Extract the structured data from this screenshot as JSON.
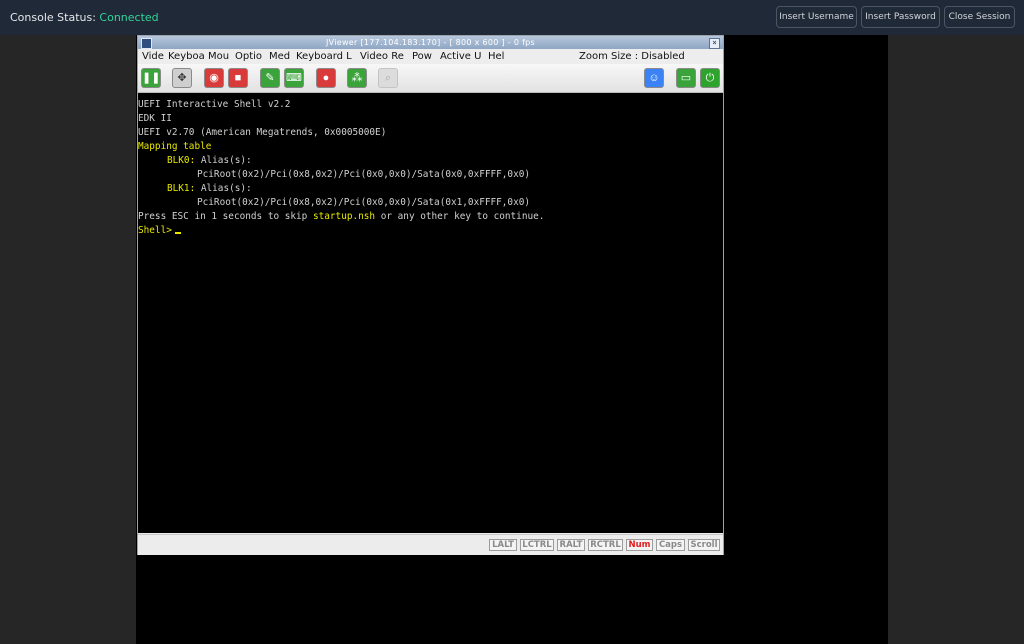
{
  "header": {
    "status_label": "Console Status:",
    "status_value": "Connected",
    "buttons": [
      {
        "label": "Insert Username"
      },
      {
        "label": "Insert Password"
      },
      {
        "label": "Close Session"
      }
    ]
  },
  "viewer": {
    "title": "JViewer [177.104.183.170] - [ 800 x 600 ] - 0 fps",
    "menu": [
      "Vide",
      "Keyboa",
      "Mou",
      "Optio",
      "Med",
      "Keyboard L",
      "Video Re",
      "Pow",
      "Active U",
      "Hel"
    ],
    "zoom_label": "Zoom Size :",
    "zoom_value": "Disabled",
    "toolbar_icons": [
      {
        "name": "pause-icon",
        "color": "#3aa33a"
      },
      {
        "name": "fullscreen-icon",
        "color": "#cfcfcf"
      },
      {
        "name": "cdrom-icon",
        "color": "#d93a3a"
      },
      {
        "name": "stop-icon",
        "color": "#d93a3a"
      },
      {
        "name": "mouse-icon",
        "color": "#3aa33a"
      },
      {
        "name": "keyboard-icon",
        "color": "#3aa33a"
      },
      {
        "name": "record-icon",
        "color": "#d93a3a"
      },
      {
        "name": "hotkeys-icon",
        "color": "#3aa33a"
      },
      {
        "name": "zoom-icon",
        "color": "#c9c9c9"
      },
      {
        "name": "user-icon",
        "color": "#3b82f6"
      },
      {
        "name": "monitor-icon",
        "color": "#3aa33a"
      },
      {
        "name": "power-icon",
        "color": "#2ea32e"
      }
    ],
    "console": {
      "line1": "UEFI Interactive Shell v2.2",
      "line2": "EDK II",
      "line3": "UEFI v2.70 (American Megatrends, 0x0005000E)",
      "mapping": "Mapping table",
      "blk0_name": "BLK0:",
      "blk0_alias": " Alias(s):",
      "blk0_path": "PciRoot(0x2)/Pci(0x8,0x2)/Pci(0x0,0x0)/Sata(0x0,0xFFFF,0x0)",
      "blk1_name": "BLK1:",
      "blk1_alias": " Alias(s):",
      "blk1_path": "PciRoot(0x2)/Pci(0x8,0x2)/Pci(0x0,0x0)/Sata(0x1,0xFFFF,0x0)",
      "press_a": "Press ESC in 1 seconds to skip ",
      "press_file": "startup.nsh",
      "press_b": " or any other key to continue.",
      "prompt": "Shell>"
    },
    "keys": [
      {
        "label": "LALT",
        "active": false
      },
      {
        "label": "LCTRL",
        "active": false
      },
      {
        "label": "RALT",
        "active": false
      },
      {
        "label": "RCTRL",
        "active": false
      },
      {
        "label": "Num",
        "active": true
      },
      {
        "label": "Caps",
        "active": false
      },
      {
        "label": "Scroll",
        "active": false
      }
    ]
  }
}
